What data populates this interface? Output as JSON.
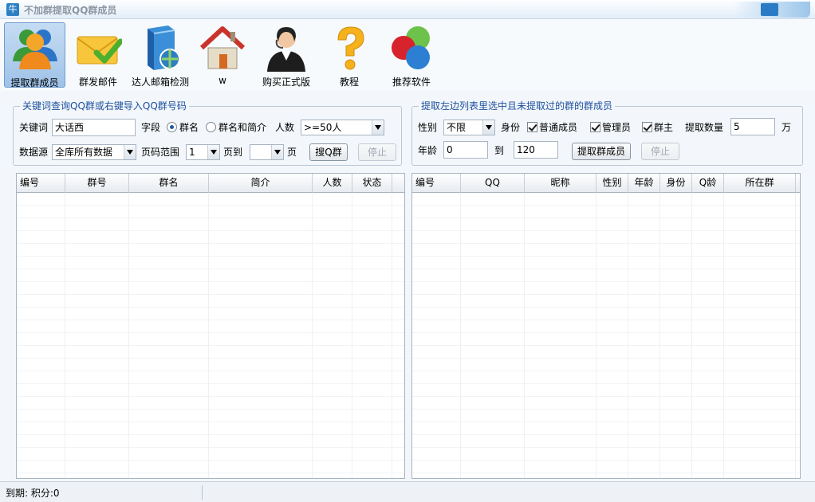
{
  "window": {
    "title": "不加群提取QQ群成员",
    "app_icon_char": "牛"
  },
  "toolbar": {
    "items": [
      {
        "label": "提取群成员",
        "icon": "users-icon",
        "active": true
      },
      {
        "label": "群发邮件",
        "icon": "mail-check-icon",
        "active": false
      },
      {
        "label": "达人邮箱检测",
        "icon": "server-globe-icon",
        "active": false
      },
      {
        "label": "w",
        "icon": "house-icon",
        "active": false
      },
      {
        "label": "购买正式版",
        "icon": "support-agent-icon",
        "active": false
      },
      {
        "label": "教程",
        "icon": "question-mark-icon",
        "active": false
      },
      {
        "label": "推荐软件",
        "icon": "color-circles-icon",
        "active": false
      }
    ]
  },
  "left_panel": {
    "title": "关键词查询QQ群或右键导入QQ群号码",
    "keyword_label": "关键词",
    "keyword_value": "大话西",
    "field_label": "字段",
    "radio_name": "群名",
    "radio_name_desc": "群名和简介",
    "radio_selected": "群名",
    "count_label": "人数",
    "count_value": ">=50人",
    "source_label": "数据源",
    "source_value": "全库所有数据",
    "page_range_label": "页码范围",
    "page_from": "1",
    "page_to_label": "页到",
    "page_to": "",
    "page_suffix": "页",
    "search_button": "搜Q群",
    "stop_button": "停止"
  },
  "right_panel": {
    "title": "提取左边列表里选中且未提取过的群的群成员",
    "gender_label": "性别",
    "gender_value": "不限",
    "identity_label": "身份",
    "check_normal": "普通成员",
    "check_admin": "管理员",
    "check_owner": "群主",
    "extract_count_label": "提取数量",
    "extract_count_value": "5",
    "extract_unit": "万",
    "age_label": "年龄",
    "age_from": "0",
    "age_to_label": "到",
    "age_to": "120",
    "extract_button": "提取群成员",
    "stop_button": "停止"
  },
  "left_grid": {
    "columns": [
      "编号",
      "群号",
      "群名",
      "简介",
      "人数",
      "状态"
    ]
  },
  "right_grid": {
    "columns": [
      "编号",
      "QQ",
      "昵称",
      "性别",
      "年龄",
      "身份",
      "Q龄",
      "所在群"
    ]
  },
  "status": {
    "text": "到期: 积分:0"
  }
}
